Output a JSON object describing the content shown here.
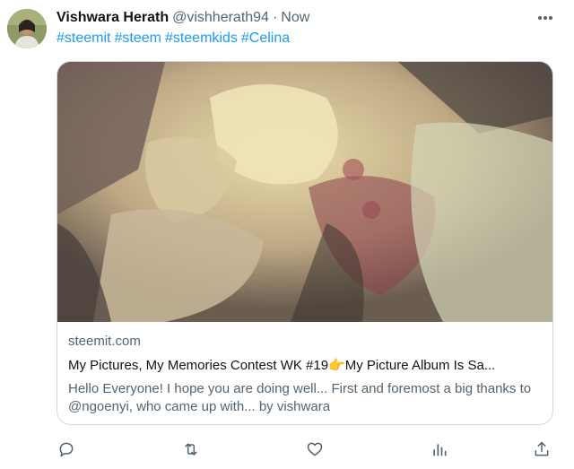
{
  "tweet": {
    "author_name": "Vishwara Herath",
    "handle": "@vishherath94",
    "separator": "·",
    "timestamp": "Now",
    "hashtags": [
      "#steemit",
      "#steem",
      "#steemkids",
      "#Celina"
    ]
  },
  "link_card": {
    "domain": "steemit.com",
    "title": "My Pictures, My Memories Contest WK #19👉My Picture Album Is Sa...",
    "description": "Hello Everyone! I hope you are doing well... First and foremost a big thanks to @ngoenyi, who came up with... by vishwara"
  },
  "icons": {
    "more": "more-horizontal-icon",
    "reply": "reply-icon",
    "retweet": "retweet-icon",
    "like": "like-icon",
    "views": "views-icon",
    "share": "share-icon"
  },
  "colors": {
    "link": "#1d9bf0",
    "secondary_text": "#536471",
    "border": "#cfd9de"
  }
}
